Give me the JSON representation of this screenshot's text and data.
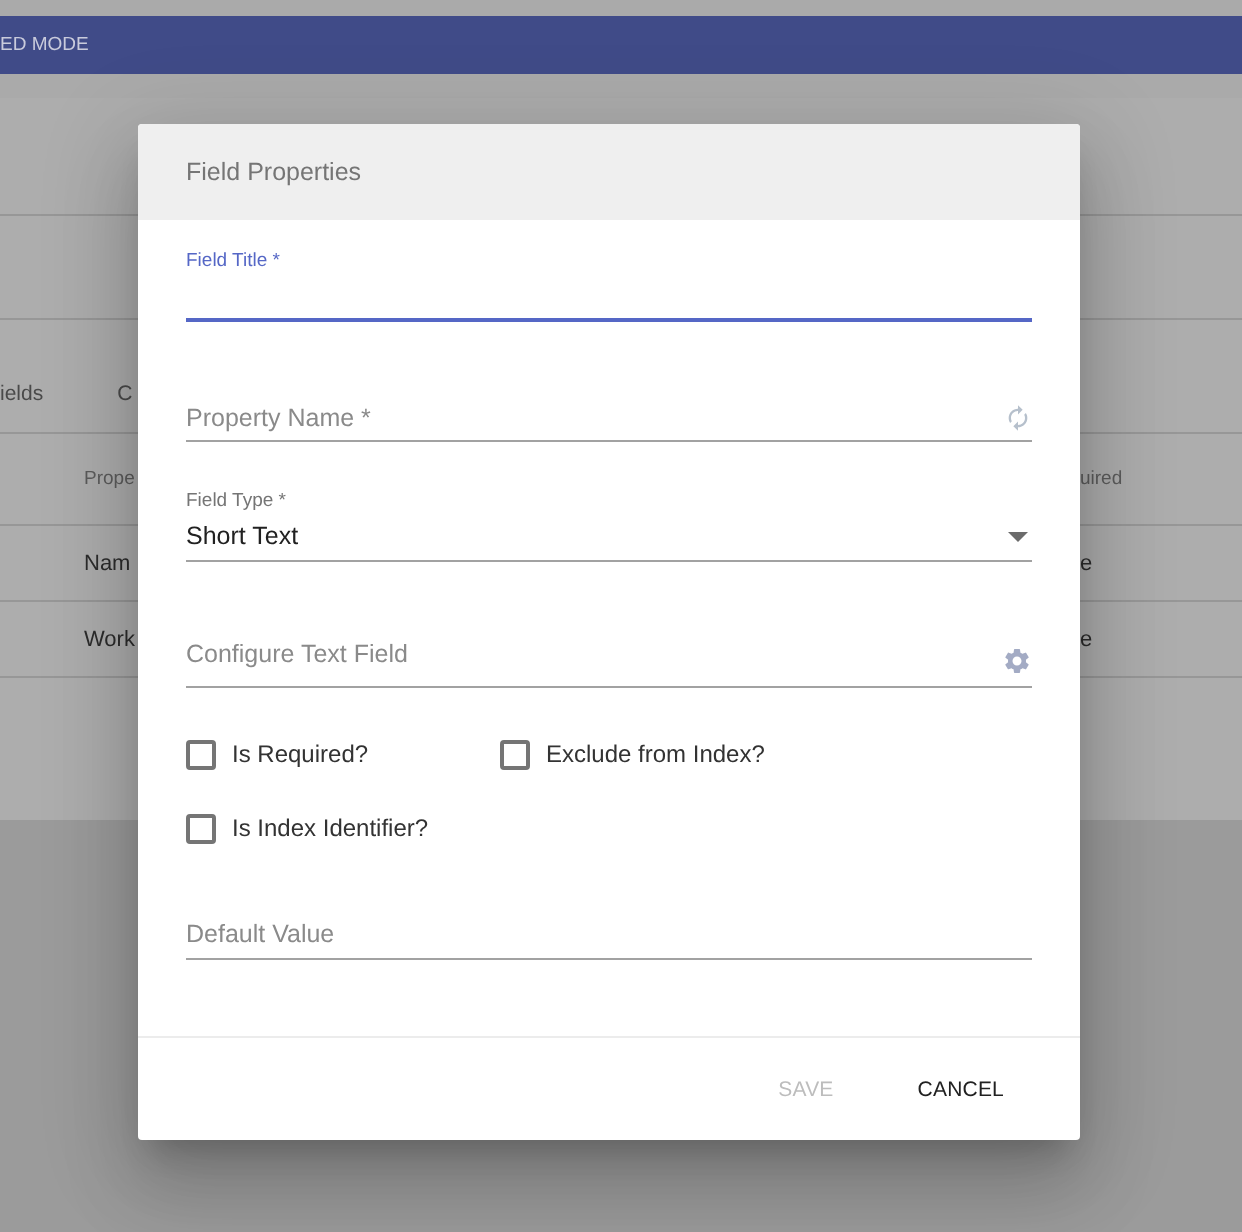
{
  "background": {
    "app_bar": {
      "title": "ED MODE"
    },
    "tabs": [
      "ields",
      "C"
    ],
    "table": {
      "columns": [
        "Prope",
        "uired"
      ],
      "rows": [
        [
          "Nam",
          "e"
        ],
        [
          "Work",
          "e"
        ]
      ]
    }
  },
  "dialog": {
    "title": "Field Properties",
    "fields": [
      {
        "kind": "text",
        "label": "Field Title *",
        "focused": true
      },
      {
        "kind": "generated",
        "placeholder": "Property Name *",
        "focused": false
      },
      {
        "kind": "select",
        "label": "Field Type *",
        "value": "Short Text",
        "focused": false
      },
      {
        "kind": "configure",
        "placeholder": "Configure Text Field",
        "focused": false
      }
    ],
    "checkboxes": [
      {
        "label": "Is Required?",
        "checked": false
      },
      {
        "label": "Exclude from Index?",
        "checked": false
      },
      {
        "label": "Is Index Identifier?",
        "checked": false
      }
    ],
    "default_field": {
      "kind": "text",
      "placeholder": "Default Value",
      "focused": false
    },
    "buttons": [
      {
        "label": "SAVE",
        "disabled": true
      },
      {
        "label": "CANCEL",
        "disabled": false
      }
    ]
  }
}
